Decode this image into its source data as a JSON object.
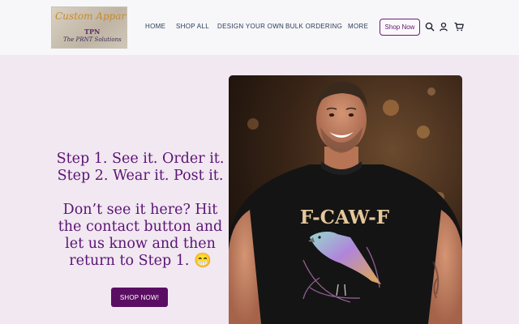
{
  "logo": {
    "script_text": "Custom Apparel",
    "tpn": "TPN",
    "subtitle": "The PRNT Solutions"
  },
  "nav": {
    "items": [
      "HOME",
      "SHOP ALL",
      "DESIGN YOUR OWN",
      "BULK ORDERING",
      "MORE"
    ]
  },
  "header": {
    "shop_now_label": "Shop Now",
    "icons": [
      "search-icon",
      "account-icon",
      "cart-icon"
    ]
  },
  "hero": {
    "line1": "Step 1. See it. Order it.",
    "line2": "Step 2. Wear it. Post it.",
    "line3": "Don’t see it here? Hit",
    "line4": "the contact button and",
    "line5": "let us know and then",
    "line6": "return to Step 1. 😁",
    "cta_label": "SHOP NOW!",
    "shirt_text": "F-CAW-F"
  },
  "colors": {
    "accent": "#5a0e62",
    "text_purple": "#5b1474",
    "nav_text": "#2b3a5a",
    "page_bg": "#f1e8f1"
  }
}
